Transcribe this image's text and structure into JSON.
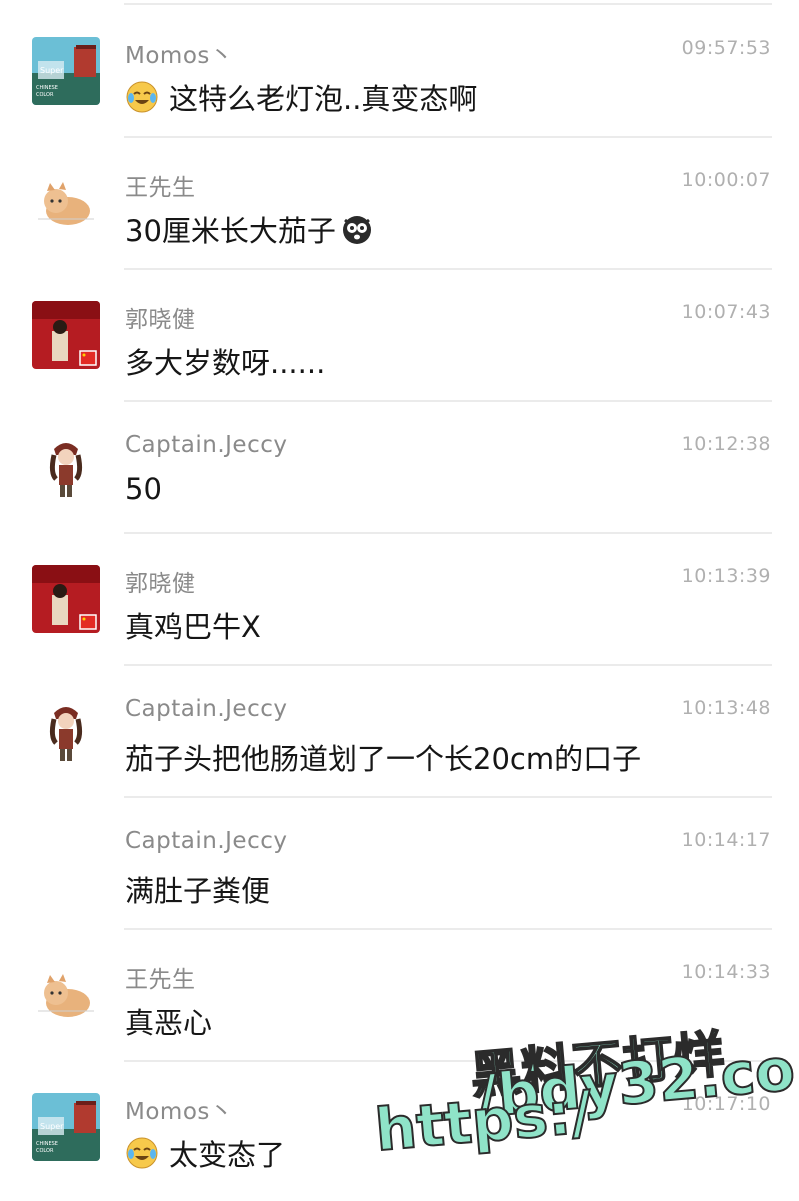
{
  "messages": [
    {
      "sender": "Momos丶",
      "time": "09:57:53",
      "text": "这特么老灯泡..真变态啊",
      "avatar": "landscape-avatar",
      "emoji": "laughing-tears-emoji",
      "emoji_position": "before"
    },
    {
      "sender": "王先生",
      "time": "10:00:07",
      "text": "30厘米长大茄子",
      "avatar": "cat-avatar",
      "emoji": "shocked-face-emoji",
      "emoji_position": "after"
    },
    {
      "sender": "郭晓健",
      "time": "10:07:43",
      "text": "多大岁数呀......",
      "avatar": "red-photo-avatar",
      "emoji": "",
      "emoji_position": ""
    },
    {
      "sender": "Captain.Jeccy",
      "time": "10:12:38",
      "text": "50",
      "avatar": "pirate-girl-avatar",
      "emoji": "",
      "emoji_position": ""
    },
    {
      "sender": "郭晓健",
      "time": "10:13:39",
      "text": "真鸡巴牛X",
      "avatar": "red-photo-avatar",
      "emoji": "",
      "emoji_position": ""
    },
    {
      "sender": "Captain.Jeccy",
      "time": "10:13:48",
      "text": "茄子头把他肠道划了一个长20cm的口子",
      "avatar": "pirate-girl-avatar",
      "emoji": "",
      "emoji_position": ""
    },
    {
      "sender": "Captain.Jeccy",
      "time": "10:14:17",
      "text": "满肚子粪便",
      "avatar": "",
      "emoji": "",
      "emoji_position": ""
    },
    {
      "sender": "王先生",
      "time": "10:14:33",
      "text": "真恶心",
      "avatar": "cat-avatar",
      "emoji": "",
      "emoji_position": ""
    },
    {
      "sender": "Momos丶",
      "time": "10:17:10",
      "text": "太变态了",
      "avatar": "landscape-avatar",
      "emoji": "laughing-tears-emoji",
      "emoji_position": "before"
    }
  ],
  "watermark": {
    "line1": "黑料不打烊",
    "https": "https:/",
    "domain": "/bdy32.co"
  },
  "colors": {
    "sender": "#8a8a8a",
    "time": "#b0b0b0",
    "text": "#161616",
    "divider": "#ebebeb",
    "watermark_fill": "#8fe3c8"
  }
}
